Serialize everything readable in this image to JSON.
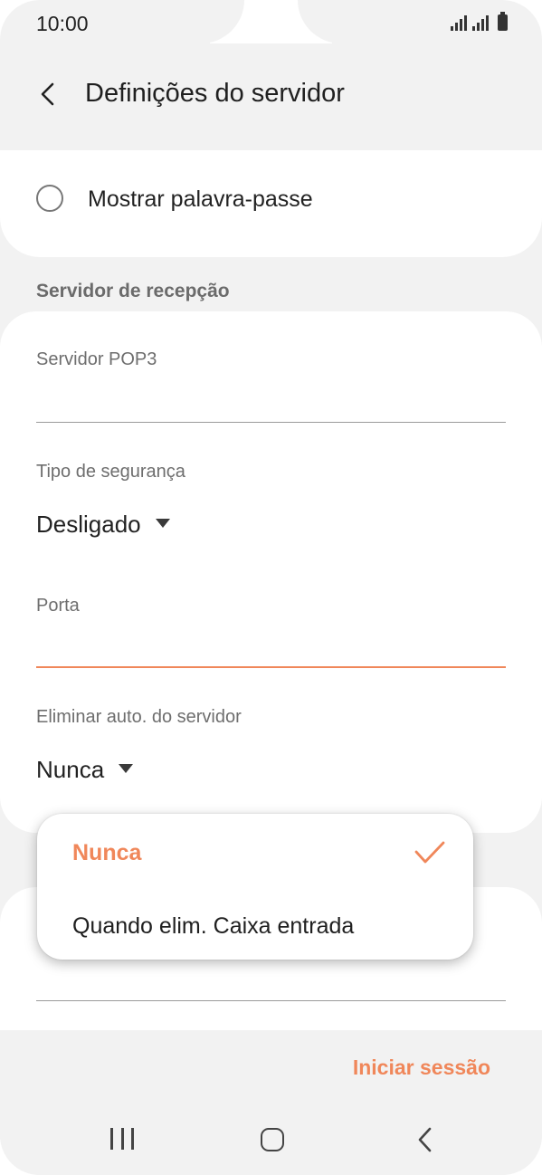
{
  "status_bar": {
    "time": "10:00"
  },
  "header": {
    "title": "Definições do servidor"
  },
  "show_password": {
    "label": "Mostrar palavra-passe"
  },
  "incoming_section": {
    "title": "Servidor de recepção"
  },
  "fields": {
    "server": {
      "label": "Servidor POP3",
      "value": ""
    },
    "security": {
      "label": "Tipo de segurança",
      "value": "Desligado"
    },
    "port": {
      "label": "Porta",
      "value": ""
    },
    "auto_delete": {
      "label": "Eliminar auto. do servidor",
      "value": "Nunca"
    }
  },
  "dropdown": {
    "options": [
      {
        "label": "Nunca",
        "selected": true
      },
      {
        "label": "Quando elim. Caixa entrada",
        "selected": false
      }
    ]
  },
  "footer": {
    "signin_label": "Iniciar sessão"
  },
  "colors": {
    "accent": "#f0875a",
    "background": "#f2f2f2",
    "card": "#ffffff"
  },
  "icons": [
    "back-icon",
    "signal-icon",
    "battery-icon",
    "radio-icon",
    "dropdown-arrow-icon",
    "check-icon",
    "recents-icon",
    "home-icon",
    "nav-back-icon"
  ]
}
